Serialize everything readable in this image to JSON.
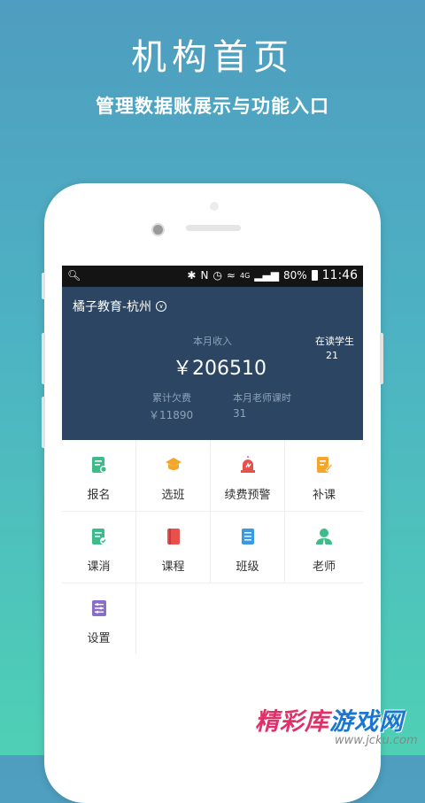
{
  "promo": {
    "title": "机构首页",
    "subtitle": "管理数据账展示与功能入口"
  },
  "status_bar": {
    "battery": "80%",
    "time": "11:46",
    "network": "4G"
  },
  "header": {
    "org_name": "橘子教育-杭州",
    "income_label": "本月收入",
    "income_value": "￥206510",
    "students_label": "在读学生",
    "students_value": "21",
    "debt_label": "累计欠费",
    "debt_value": "￥11890",
    "hours_label": "本月老师课时",
    "hours_value": "31"
  },
  "menu": [
    {
      "label": "报名",
      "icon": "signup-icon",
      "color": "#3dbb8a"
    },
    {
      "label": "选班",
      "icon": "graduation-cap-icon",
      "color": "#f4a62a"
    },
    {
      "label": "续费预警",
      "icon": "alarm-icon",
      "color": "#e8504c"
    },
    {
      "label": "补课",
      "icon": "makeup-class-icon",
      "color": "#f4a62a"
    },
    {
      "label": "课消",
      "icon": "course-consume-icon",
      "color": "#3dbb8a"
    },
    {
      "label": "课程",
      "icon": "book-icon",
      "color": "#e8504c"
    },
    {
      "label": "班级",
      "icon": "class-list-icon",
      "color": "#3a9ae0"
    },
    {
      "label": "老师",
      "icon": "teacher-icon",
      "color": "#3dbb8a"
    },
    {
      "label": "设置",
      "icon": "settings-icon",
      "color": "#8a6fc7"
    }
  ],
  "watermark": {
    "text_red": "精彩库",
    "text_blue": "游戏网",
    "url": "www.jcku.com"
  }
}
